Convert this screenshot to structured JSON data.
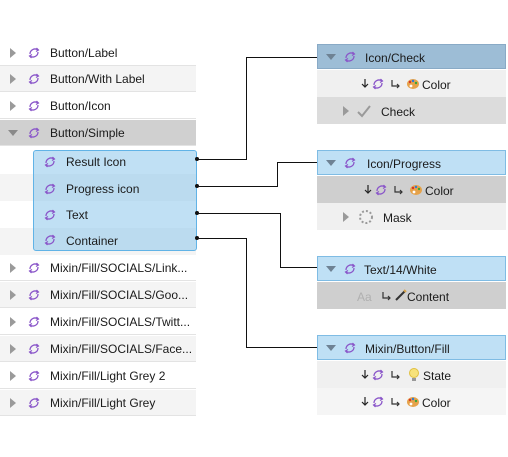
{
  "layers": [
    {
      "label": "Button/Label"
    },
    {
      "label": "Button/With Label"
    },
    {
      "label": "Button/Icon"
    },
    {
      "label": "Button/Simple"
    },
    {
      "label": "Mixin/Fill/SOCIALS/Link..."
    },
    {
      "label": "Mixin/Fill/SOCIALS/Goo..."
    },
    {
      "label": "Mixin/Fill/SOCIALS/Twitt..."
    },
    {
      "label": "Mixin/Fill/SOCIALS/Face..."
    },
    {
      "label": "Mixin/Fill/Light Grey 2"
    },
    {
      "label": "Mixin/Fill/Light Grey"
    }
  ],
  "children": [
    {
      "label": "Result Icon"
    },
    {
      "label": "Progress icon"
    },
    {
      "label": "Text"
    },
    {
      "label": "Container"
    }
  ],
  "panels": {
    "icon_check": {
      "title": "Icon/Check",
      "color_label": "Color",
      "check_label": "Check"
    },
    "icon_progress": {
      "title": "Icon/Progress",
      "color_label": "Color",
      "mask_label": "Mask"
    },
    "text_white": {
      "title": "Text/14/White",
      "aa": "Aa",
      "content_label": "Content"
    },
    "mixin_fill": {
      "title": "Mixin/Button/Fill",
      "state_label": "State",
      "color_label": "Color"
    }
  },
  "colors": {
    "symbol_purple": "#8a56c9",
    "selection_blue": "#8cc6eb",
    "header_blue": "#bfe0f5",
    "header_dark": "#9dbdd6"
  },
  "icons": {
    "symbol": "sync-symbol-icon",
    "arrow": "return-arrow-icon",
    "palette": "palette-icon",
    "bulb": "lightbulb-icon",
    "pen": "pen-icon",
    "check": "checkmark-icon",
    "spinner": "spinner-icon"
  }
}
